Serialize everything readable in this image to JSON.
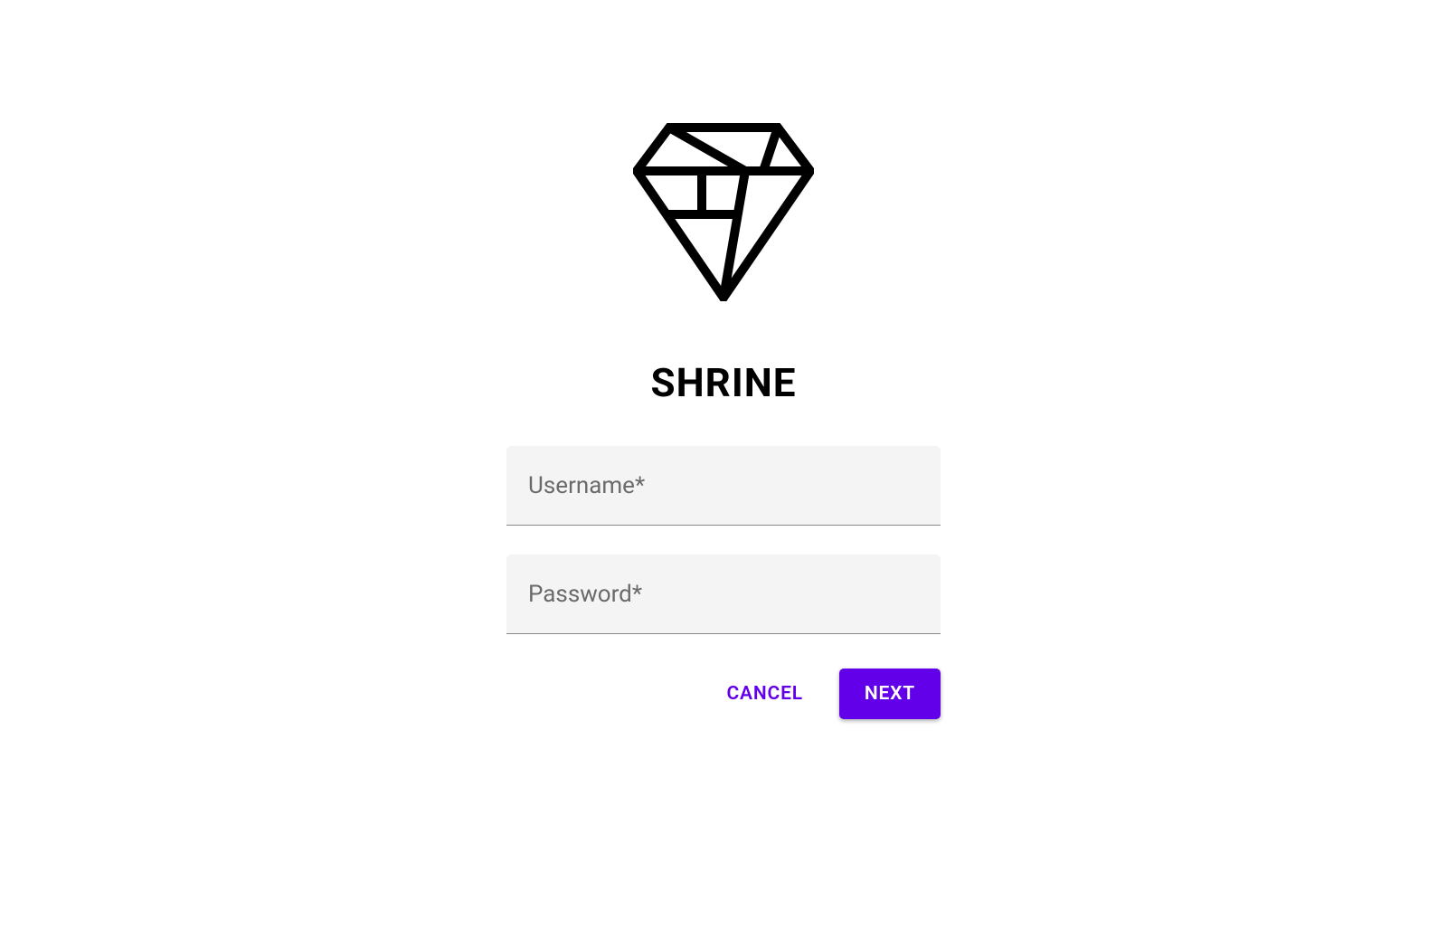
{
  "app": {
    "title": "SHRINE",
    "logo_name": "diamond-icon"
  },
  "fields": {
    "username": {
      "placeholder": "Username*",
      "value": ""
    },
    "password": {
      "placeholder": "Password*",
      "value": ""
    }
  },
  "actions": {
    "cancel_label": "CANCEL",
    "next_label": "NEXT"
  },
  "colors": {
    "accent": "#6200ea",
    "input_bg": "#f4f4f4",
    "input_underline": "#8a8a8a",
    "text_muted": "#6a6a6a"
  }
}
